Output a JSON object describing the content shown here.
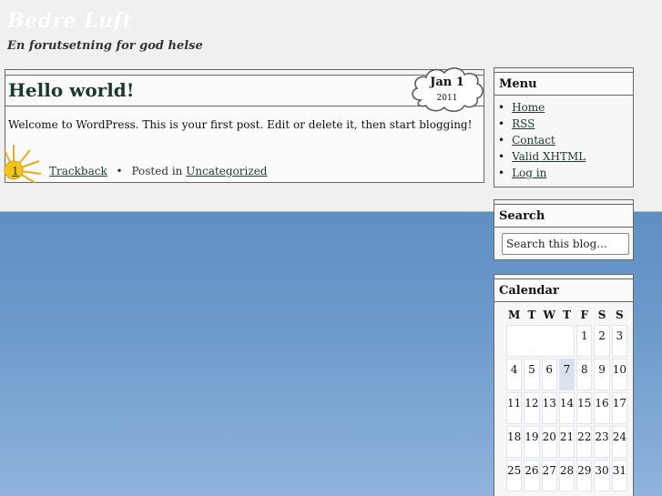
{
  "site": {
    "title": "Bedre Luft",
    "tagline": "En forutsetning for god helse"
  },
  "post": {
    "title": "Hello world!",
    "body": "Welcome to WordPress. This is your first post. Edit or delete it, then start blogging!",
    "date_month_day": "Jan 1",
    "date_year": "2011",
    "comment_count": "1",
    "trackback_label": "Trackback",
    "posted_in_label": "Posted in",
    "category": "Uncategorized",
    "separator": "•"
  },
  "sidebar": {
    "menu": {
      "title": "Menu",
      "items": [
        {
          "label": "Home"
        },
        {
          "label": "RSS"
        },
        {
          "label": "Contact"
        },
        {
          "label": "Valid XHTML"
        },
        {
          "label": "Log in"
        }
      ]
    },
    "search": {
      "title": "Search",
      "value": "Search this blog..."
    },
    "calendar": {
      "title": "Calendar",
      "weekdays": [
        "M",
        "T",
        "W",
        "T",
        "F",
        "S",
        "S"
      ],
      "weeks": [
        [
          "",
          "",
          "",
          "",
          "1",
          "2",
          "3"
        ],
        [
          "4",
          "5",
          "6",
          "7",
          "8",
          "9",
          "10"
        ],
        [
          "11",
          "12",
          "13",
          "14",
          "15",
          "16",
          "17"
        ],
        [
          "18",
          "19",
          "20",
          "21",
          "22",
          "23",
          "24"
        ],
        [
          "25",
          "26",
          "27",
          "28",
          "29",
          "30",
          "31"
        ]
      ],
      "today": "7"
    }
  },
  "colors": {
    "sky_top": "#5f8fc2",
    "sky_bottom": "#8fb3dc",
    "link": "#1d3b2c",
    "sun": "#f5c518"
  }
}
